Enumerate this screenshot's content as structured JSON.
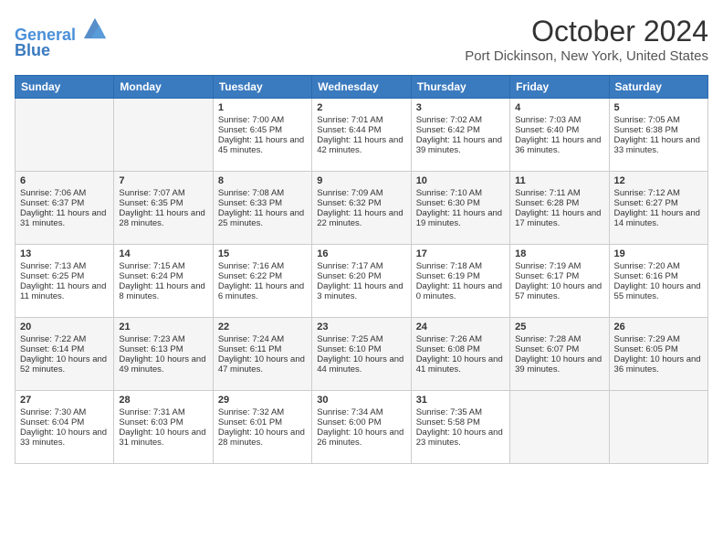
{
  "header": {
    "logo_line1": "General",
    "logo_line2": "Blue",
    "month": "October 2024",
    "location": "Port Dickinson, New York, United States"
  },
  "weekdays": [
    "Sunday",
    "Monday",
    "Tuesday",
    "Wednesday",
    "Thursday",
    "Friday",
    "Saturday"
  ],
  "weeks": [
    [
      {
        "day": "",
        "empty": true
      },
      {
        "day": "",
        "empty": true
      },
      {
        "day": "1",
        "sunrise": "7:00 AM",
        "sunset": "6:45 PM",
        "daylight": "11 hours and 45 minutes."
      },
      {
        "day": "2",
        "sunrise": "7:01 AM",
        "sunset": "6:44 PM",
        "daylight": "11 hours and 42 minutes."
      },
      {
        "day": "3",
        "sunrise": "7:02 AM",
        "sunset": "6:42 PM",
        "daylight": "11 hours and 39 minutes."
      },
      {
        "day": "4",
        "sunrise": "7:03 AM",
        "sunset": "6:40 PM",
        "daylight": "11 hours and 36 minutes."
      },
      {
        "day": "5",
        "sunrise": "7:05 AM",
        "sunset": "6:38 PM",
        "daylight": "11 hours and 33 minutes."
      }
    ],
    [
      {
        "day": "6",
        "sunrise": "7:06 AM",
        "sunset": "6:37 PM",
        "daylight": "11 hours and 31 minutes."
      },
      {
        "day": "7",
        "sunrise": "7:07 AM",
        "sunset": "6:35 PM",
        "daylight": "11 hours and 28 minutes."
      },
      {
        "day": "8",
        "sunrise": "7:08 AM",
        "sunset": "6:33 PM",
        "daylight": "11 hours and 25 minutes."
      },
      {
        "day": "9",
        "sunrise": "7:09 AM",
        "sunset": "6:32 PM",
        "daylight": "11 hours and 22 minutes."
      },
      {
        "day": "10",
        "sunrise": "7:10 AM",
        "sunset": "6:30 PM",
        "daylight": "11 hours and 19 minutes."
      },
      {
        "day": "11",
        "sunrise": "7:11 AM",
        "sunset": "6:28 PM",
        "daylight": "11 hours and 17 minutes."
      },
      {
        "day": "12",
        "sunrise": "7:12 AM",
        "sunset": "6:27 PM",
        "daylight": "11 hours and 14 minutes."
      }
    ],
    [
      {
        "day": "13",
        "sunrise": "7:13 AM",
        "sunset": "6:25 PM",
        "daylight": "11 hours and 11 minutes."
      },
      {
        "day": "14",
        "sunrise": "7:15 AM",
        "sunset": "6:24 PM",
        "daylight": "11 hours and 8 minutes."
      },
      {
        "day": "15",
        "sunrise": "7:16 AM",
        "sunset": "6:22 PM",
        "daylight": "11 hours and 6 minutes."
      },
      {
        "day": "16",
        "sunrise": "7:17 AM",
        "sunset": "6:20 PM",
        "daylight": "11 hours and 3 minutes."
      },
      {
        "day": "17",
        "sunrise": "7:18 AM",
        "sunset": "6:19 PM",
        "daylight": "11 hours and 0 minutes."
      },
      {
        "day": "18",
        "sunrise": "7:19 AM",
        "sunset": "6:17 PM",
        "daylight": "10 hours and 57 minutes."
      },
      {
        "day": "19",
        "sunrise": "7:20 AM",
        "sunset": "6:16 PM",
        "daylight": "10 hours and 55 minutes."
      }
    ],
    [
      {
        "day": "20",
        "sunrise": "7:22 AM",
        "sunset": "6:14 PM",
        "daylight": "10 hours and 52 minutes."
      },
      {
        "day": "21",
        "sunrise": "7:23 AM",
        "sunset": "6:13 PM",
        "daylight": "10 hours and 49 minutes."
      },
      {
        "day": "22",
        "sunrise": "7:24 AM",
        "sunset": "6:11 PM",
        "daylight": "10 hours and 47 minutes."
      },
      {
        "day": "23",
        "sunrise": "7:25 AM",
        "sunset": "6:10 PM",
        "daylight": "10 hours and 44 minutes."
      },
      {
        "day": "24",
        "sunrise": "7:26 AM",
        "sunset": "6:08 PM",
        "daylight": "10 hours and 41 minutes."
      },
      {
        "day": "25",
        "sunrise": "7:28 AM",
        "sunset": "6:07 PM",
        "daylight": "10 hours and 39 minutes."
      },
      {
        "day": "26",
        "sunrise": "7:29 AM",
        "sunset": "6:05 PM",
        "daylight": "10 hours and 36 minutes."
      }
    ],
    [
      {
        "day": "27",
        "sunrise": "7:30 AM",
        "sunset": "6:04 PM",
        "daylight": "10 hours and 33 minutes."
      },
      {
        "day": "28",
        "sunrise": "7:31 AM",
        "sunset": "6:03 PM",
        "daylight": "10 hours and 31 minutes."
      },
      {
        "day": "29",
        "sunrise": "7:32 AM",
        "sunset": "6:01 PM",
        "daylight": "10 hours and 28 minutes."
      },
      {
        "day": "30",
        "sunrise": "7:34 AM",
        "sunset": "6:00 PM",
        "daylight": "10 hours and 26 minutes."
      },
      {
        "day": "31",
        "sunrise": "7:35 AM",
        "sunset": "5:58 PM",
        "daylight": "10 hours and 23 minutes."
      },
      {
        "day": "",
        "empty": true
      },
      {
        "day": "",
        "empty": true
      }
    ]
  ]
}
